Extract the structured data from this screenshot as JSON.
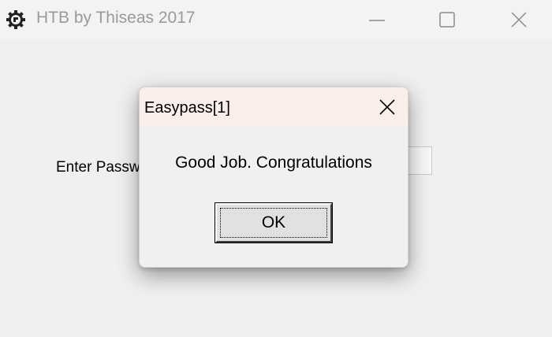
{
  "window": {
    "title": "HTB by Thiseas 2017",
    "icon": "gear-icon",
    "controls": [
      "minimize-icon",
      "maximize-icon",
      "close-icon"
    ]
  },
  "main": {
    "prompt_label": "Enter Passw",
    "password_value": ""
  },
  "dialog": {
    "title": "Easypass[1]",
    "message": "Good Job. Congratulations",
    "ok_label": "OK"
  },
  "colors": {
    "background": "#f0f0f0",
    "dialog_titlebar": "#faeeea",
    "title_text": "#9a9a9a"
  }
}
